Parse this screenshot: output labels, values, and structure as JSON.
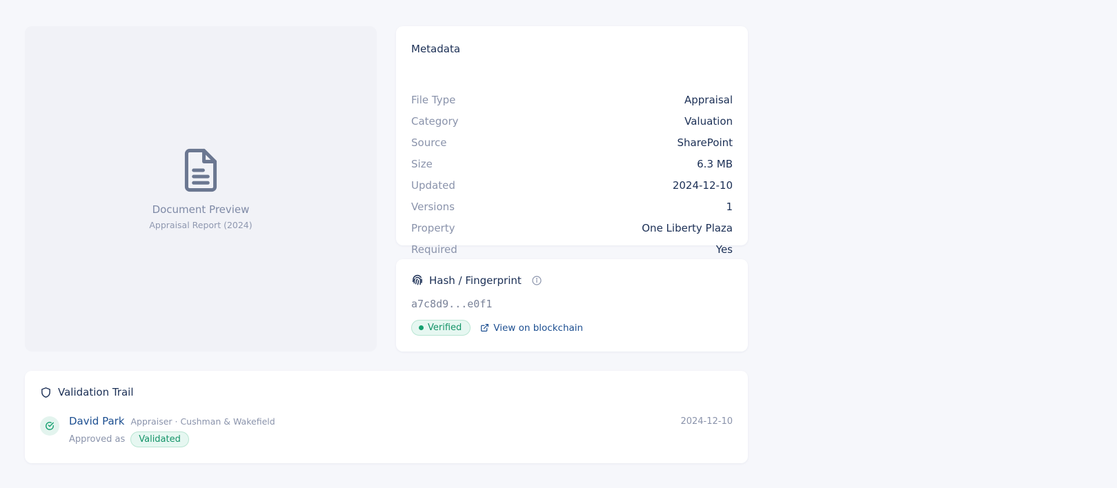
{
  "preview": {
    "icon": "document-icon",
    "title": "Document Preview",
    "subtitle": "Appraisal Report (2024)"
  },
  "metadata": {
    "title": "Metadata",
    "rows": [
      {
        "key": "File Type",
        "value": "Appraisal"
      },
      {
        "key": "Category",
        "value": "Valuation"
      },
      {
        "key": "Source",
        "value": "SharePoint"
      },
      {
        "key": "Size",
        "value": "6.3 MB"
      },
      {
        "key": "Updated",
        "value": "2024-12-10"
      },
      {
        "key": "Versions",
        "value": "1"
      },
      {
        "key": "Property",
        "value": "One Liberty Plaza"
      },
      {
        "key": "Required",
        "value": "Yes"
      }
    ]
  },
  "hash": {
    "title": "Hash / Fingerprint",
    "value": "a7c8d9...e0f1",
    "status": "Verified",
    "link_label": "View on blockchain"
  },
  "validation_trail": {
    "title": "Validation Trail",
    "entries": [
      {
        "name": "David Park",
        "role": "Appraiser · Cushman & Wakefield",
        "approved_label": "Approved as",
        "status": "Validated",
        "date": "2024-12-10"
      }
    ]
  },
  "colors": {
    "accent": "#1d4f91",
    "success": "#149468",
    "muted": "#8a93ab",
    "background": "#f6f7fb"
  }
}
